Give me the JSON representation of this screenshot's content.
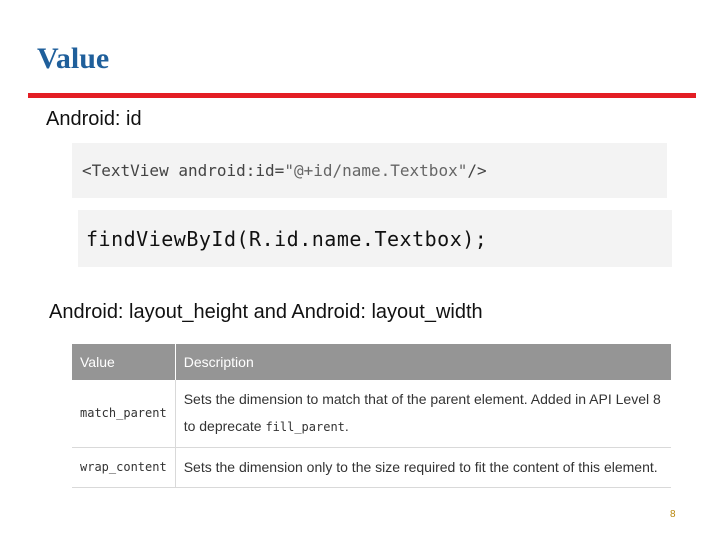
{
  "slide": {
    "title": "Value",
    "heading_id": "Android: id",
    "heading_layout": "Android: layout_height and Android: layout_width",
    "page_number": "8"
  },
  "code": {
    "textview_tag": "<TextView",
    "textview_attr": "android:id=",
    "textview_value": "\"@+id/name.Textbox\"",
    "textview_close": "/>",
    "find_view": "findViewById(R.id.name.Textbox);"
  },
  "table": {
    "headers": [
      "Value",
      "Description"
    ],
    "rows": [
      {
        "value": "match_parent",
        "description": "Sets the dimension to match that of the parent element. Added in API Level 8 to deprecate ",
        "description_code": "fill_parent",
        "description_tail": "."
      },
      {
        "value": "wrap_content",
        "description": "Sets the dimension only to the size required to fit the content of this element."
      }
    ]
  },
  "colors": {
    "title": "#1f5f9b",
    "rule": "#e31e24",
    "table_header": "#959595",
    "page_number": "#b8860b"
  }
}
